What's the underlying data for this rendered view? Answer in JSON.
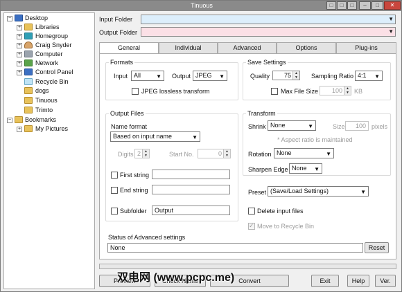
{
  "window": {
    "title": "Tinuous"
  },
  "titlebar_buttons": [
    "minimize-icon",
    "maximize-icon",
    "close-icon"
  ],
  "tree": [
    {
      "label": "Desktop",
      "icon": "desktop-icon",
      "expander": "−"
    },
    {
      "label": "Libraries",
      "icon": "libraries-icon",
      "expander": "+"
    },
    {
      "label": "Homegroup",
      "icon": "homegroup-icon",
      "expander": "+"
    },
    {
      "label": "Craig Snyder",
      "icon": "user-icon",
      "expander": "+"
    },
    {
      "label": "Computer",
      "icon": "computer-icon",
      "expander": "+"
    },
    {
      "label": "Network",
      "icon": "network-icon",
      "expander": "+"
    },
    {
      "label": "Control Panel",
      "icon": "control-panel-icon",
      "expander": "+"
    },
    {
      "label": "Recycle Bin",
      "icon": "recycle-bin-icon",
      "expander": ""
    },
    {
      "label": "dogs",
      "icon": "folder-icon",
      "expander": ""
    },
    {
      "label": "Tinuous",
      "icon": "folder-icon",
      "expander": ""
    },
    {
      "label": "Trimto",
      "icon": "folder-icon",
      "expander": ""
    },
    {
      "label": "Bookmarks",
      "icon": "folder-icon",
      "expander": "−"
    },
    {
      "label": "My Pictures",
      "icon": "folder-icon",
      "expander": "+"
    }
  ],
  "input_folder": {
    "label": "Input Folder",
    "value": "",
    "color": "#dceefb"
  },
  "output_folder": {
    "label": "Output Folder",
    "value": "",
    "color": "#fbe0e6"
  },
  "tabs": [
    "General",
    "Individual",
    "Advanced",
    "Options",
    "Plug-ins"
  ],
  "active_tab": "General",
  "formats": {
    "title": "Formats",
    "input_label": "Input",
    "input_value": "All",
    "output_label": "Output",
    "output_value": "JPEG",
    "lossless_label": "JPEG lossless transform",
    "lossless_checked": false
  },
  "save_settings": {
    "title": "Save Settings",
    "quality_label": "Quality",
    "quality_value": "75",
    "sampling_label": "Sampling Ratio",
    "sampling_value": "4:1",
    "maxsize_label": "Max File Size",
    "maxsize_checked": false,
    "maxsize_value": "100",
    "maxsize_unit": "KB"
  },
  "output_files": {
    "title": "Output Files",
    "name_format_label": "Name format",
    "name_format_value": "Based on input name",
    "digits_label": "Digits",
    "digits_value": "2",
    "start_label": "Start No.",
    "start_value": "0",
    "first_string_label": "First string",
    "first_string_value": "",
    "end_string_label": "End string",
    "end_string_value": "",
    "subfolder_label": "Subfolder",
    "subfolder_value": "Output"
  },
  "transform": {
    "title": "Transform",
    "shrink_label": "Shrink",
    "shrink_value": "None",
    "size_label": "Size",
    "size_value": "100",
    "size_unit": "pixels",
    "aspect_note": "* Aspect ratio is maintained",
    "rotation_label": "Rotation",
    "rotation_value": "None",
    "sharpen_label": "Sharpen Edge",
    "sharpen_value": "None"
  },
  "preset": {
    "label": "Preset",
    "value": "(Save/Load Settings)"
  },
  "delete_input": {
    "label": "Delete input files",
    "checked": false
  },
  "move_recycle": {
    "label": "Move to Recycle Bin",
    "checked": true
  },
  "status": {
    "label": "Status of Advanced settings",
    "value": "None",
    "reset_label": "Reset"
  },
  "bottom_buttons": {
    "preview": "Preview",
    "check_name": "Check Name",
    "convert": "Convert",
    "exit": "Exit",
    "help": "Help",
    "ver": "Ver."
  },
  "watermark": "双电网 (www.pcpc.me)"
}
